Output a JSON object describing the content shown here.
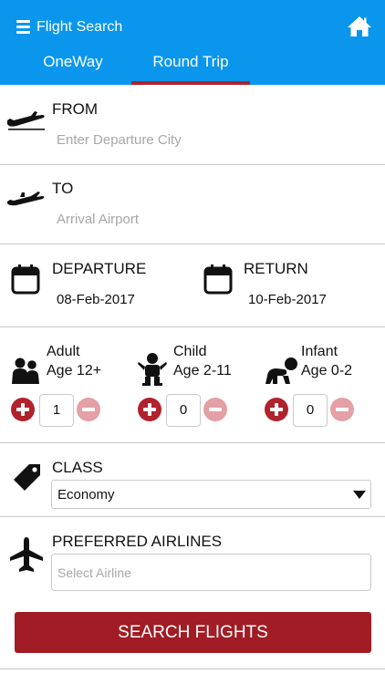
{
  "header": {
    "title": "Flight Search",
    "menu_icon": "hamburger-menu-icon",
    "home_icon": "home-icon",
    "background": "#0a96ec"
  },
  "tabs": [
    {
      "label": "OneWay",
      "selected": false
    },
    {
      "label": "Round Trip",
      "selected": true
    }
  ],
  "accent_color": "#b0222c",
  "from": {
    "label": "FROM",
    "placeholder": "Enter Departure City",
    "icon": "plane-takeoff-icon"
  },
  "to": {
    "label": "TO",
    "placeholder": "Arrival Airport",
    "icon": "plane-landing-icon"
  },
  "departure": {
    "label": "DEPARTURE",
    "date": "08-Feb-2017",
    "icon": "calendar-icon"
  },
  "return": {
    "label": "RETURN",
    "date": "10-Feb-2017",
    "icon": "calendar-icon"
  },
  "passengers": [
    {
      "type": "Adult",
      "age": "Age 12+",
      "count": "1",
      "icon": "adults-icon"
    },
    {
      "type": "Child",
      "age": "Age 2-11",
      "count": "0",
      "icon": "child-icon"
    },
    {
      "type": "Infant",
      "age": "Age 0-2",
      "count": "0",
      "icon": "infant-icon"
    }
  ],
  "travel_class": {
    "label": "CLASS",
    "selected": "Economy",
    "icon": "tag-icon"
  },
  "preferred_airlines": {
    "label": "PREFERRED AIRLINES",
    "placeholder": "Select Airline",
    "icon": "airplane-icon"
  },
  "search_button": {
    "label": "SEARCH FLIGHTS"
  }
}
